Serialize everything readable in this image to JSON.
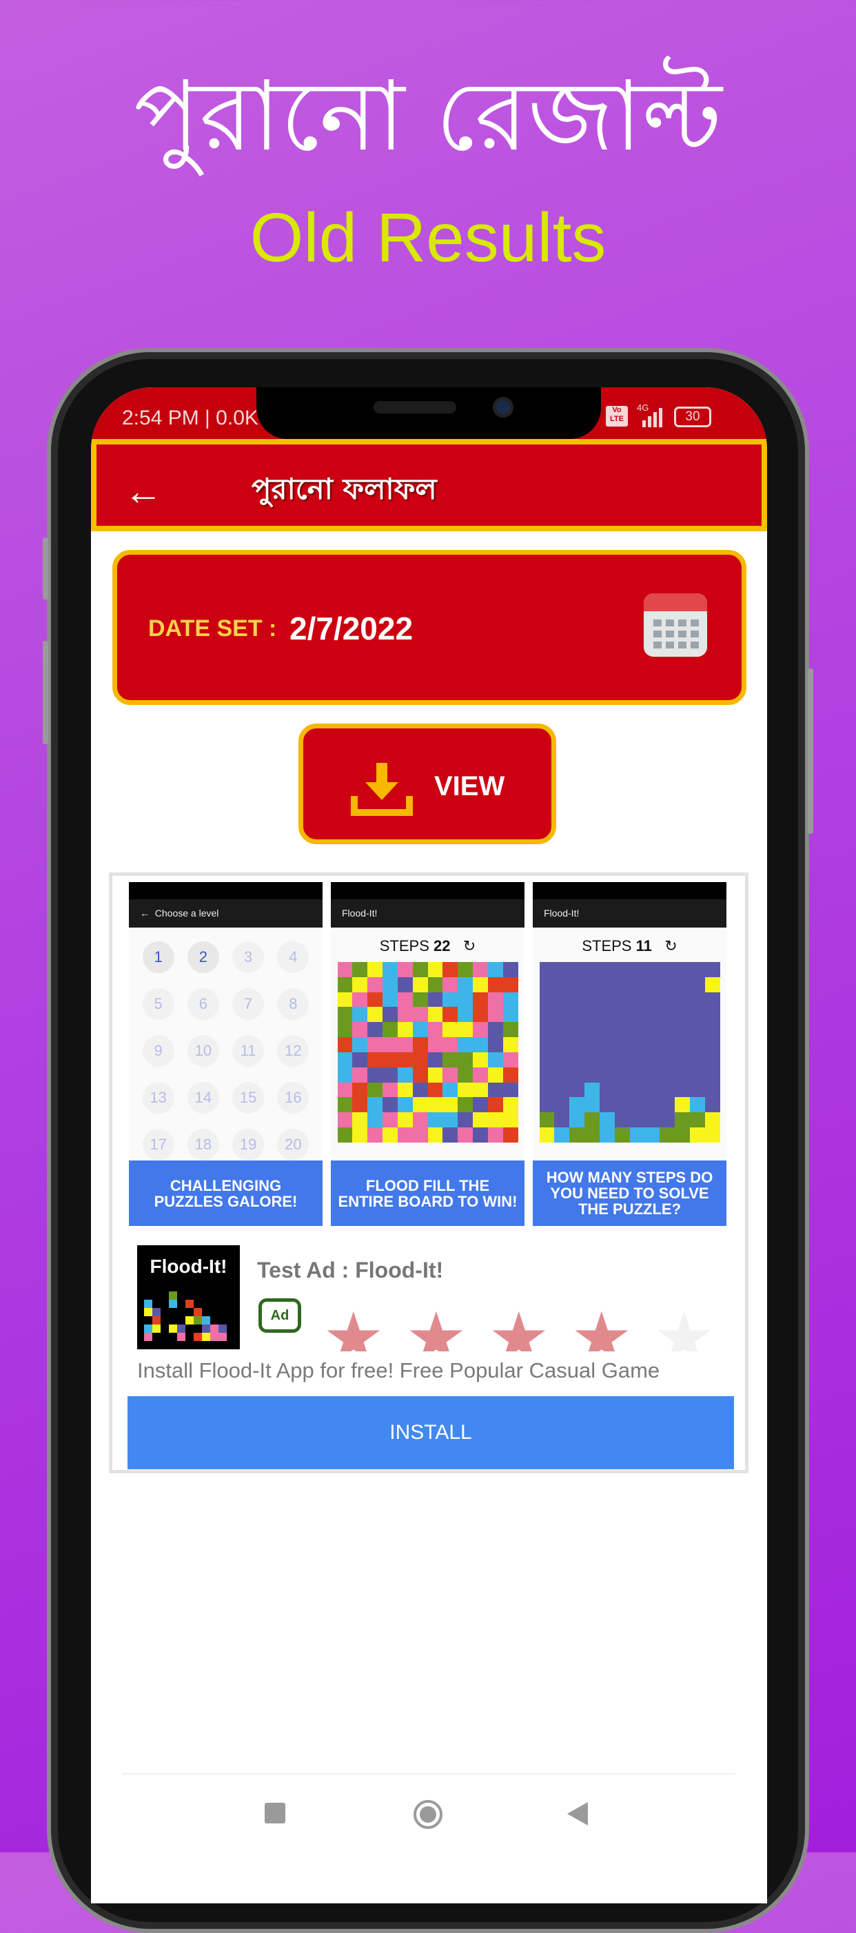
{
  "hero": {
    "title_bn": "পুরানো রেজাল্ট",
    "title_en": "Old Results"
  },
  "status_bar": {
    "time": "2:54 PM | 0.0K",
    "network": "4G",
    "volte": "Vo LTE",
    "battery": "30"
  },
  "app_bar": {
    "title": "পুরানো ফলাফল",
    "back_icon": "arrow-left-icon"
  },
  "date": {
    "label": "DATE SET :",
    "value": "2/7/2022",
    "icon": "calendar-icon"
  },
  "view_button": {
    "label": "VIEW",
    "icon": "download-icon"
  },
  "ad": {
    "screenshots": [
      {
        "header": "Choose a level",
        "levels": [
          "1",
          "2",
          "3",
          "4",
          "5",
          "6",
          "7",
          "8",
          "9",
          "10",
          "11",
          "12",
          "13",
          "14",
          "15",
          "16",
          "17",
          "18",
          "19",
          "20"
        ],
        "caption": "CHALLENGING PUZZLES GALORE!"
      },
      {
        "header": "Flood-It!",
        "steps_label": "STEPS",
        "steps": "22",
        "caption": "FLOOD FILL THE ENTIRE BOARD TO WIN!"
      },
      {
        "header": "Flood-It!",
        "steps_label": "STEPS",
        "steps": "11",
        "caption": "HOW MANY STEPS DO YOU NEED TO SOLVE THE PUZZLE?"
      }
    ],
    "icon_text": "Flood-It!",
    "title": "Test Ad : Flood-It!",
    "badge": "Ad",
    "rating": 4,
    "rating_max": 5,
    "description": "Install Flood-It App for free! Free Popular Casual Game",
    "install_label": "INSTALL",
    "button_color": "#4288f1"
  },
  "colors": {
    "primary": "#cc0010",
    "accent": "#f6b800",
    "hero_en": "#d7ea00"
  }
}
